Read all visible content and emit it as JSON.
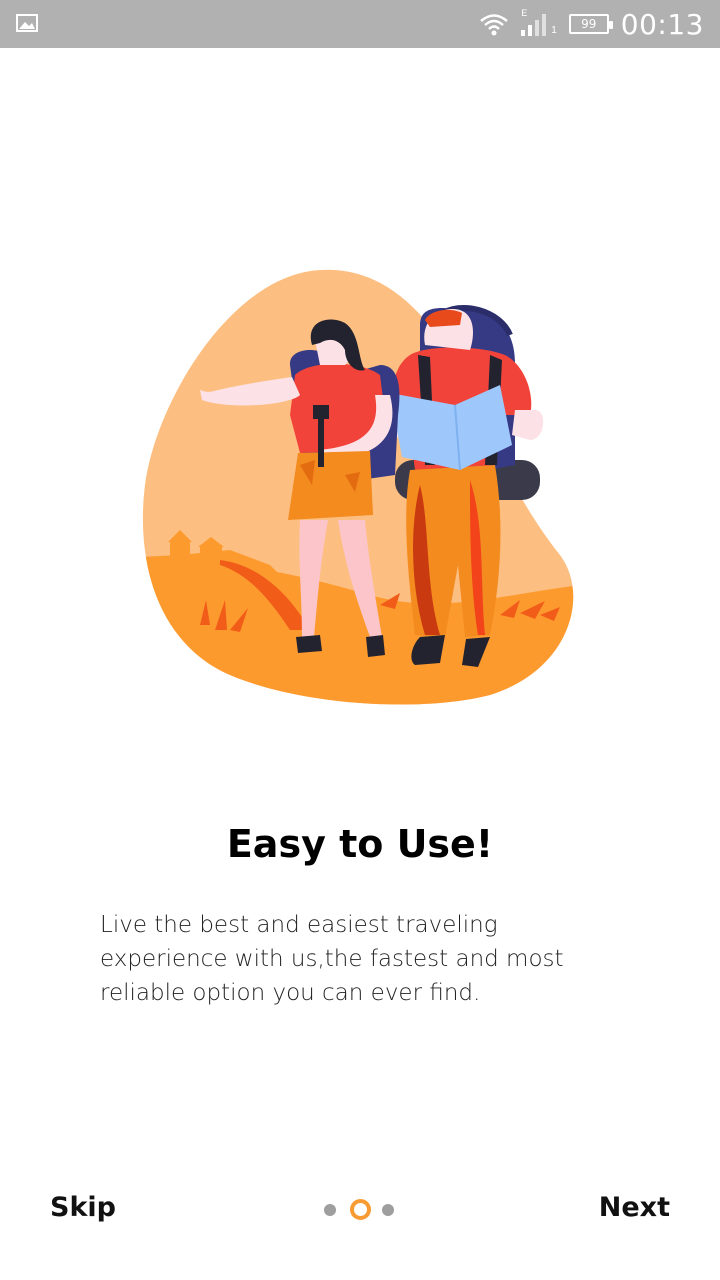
{
  "status_bar": {
    "time": "00:13",
    "battery": "99",
    "network_type": "E",
    "sim_slot": "1"
  },
  "onboarding": {
    "title": "Easy to Use!",
    "description": "Live the best and easiest traveling experience with us,the fastest and most reliable option you can ever find.",
    "illustration": "travelers-with-map-illustration"
  },
  "footer": {
    "skip_label": "Skip",
    "next_label": "Next",
    "page_indicator": {
      "total": 3,
      "current": 2
    }
  },
  "colors": {
    "accent": "#f89b32",
    "status_bar": "#b1b1b1",
    "dot_inactive": "#9e9e9e",
    "blob": "#fdbf81",
    "ground": "#fd9a2e"
  }
}
